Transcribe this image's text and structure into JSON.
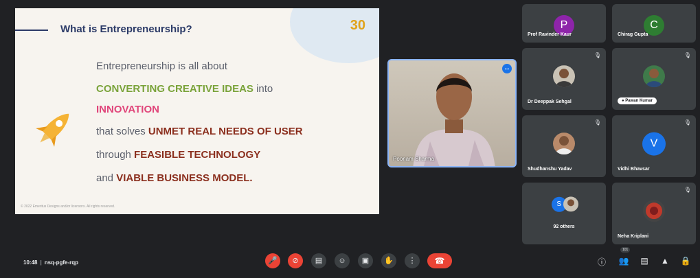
{
  "slide": {
    "title": "What is Entrepreneurship?",
    "logo_num": "30",
    "line1": "Entrepreneurship is all about",
    "line2_bold": "CONVERTING CREATIVE IDEAS",
    "line2_rest": " into",
    "line3": "INNOVATION",
    "line4_pre": "that solves ",
    "line4_bold": "UNMET REAL NEEDS OF USER",
    "line5_pre": "through ",
    "line5_bold": "FEASIBLE TECHNOLOGY",
    "line6_pre": "and ",
    "line6_bold": "VIABLE BUSINESS MODEL.",
    "footer": "© 2022 Emeritus Designs and/or licensors. All rights reserved."
  },
  "speaker": {
    "name": "Poonam Sharma"
  },
  "participants": [
    {
      "name": "Prof Ravinder Kaur",
      "initial": "P",
      "color": "#8e24aa"
    },
    {
      "name": "Chirag Gupta",
      "initial": "C",
      "color": "#2e7d32"
    },
    {
      "name": "Dr Deeppak Sehgal"
    },
    {
      "name": "Pawan Kumar"
    },
    {
      "name": "Shudhanshu Yadav"
    },
    {
      "name": "Vidhi Bhavsar",
      "initial": "V",
      "color": "#1a73e8"
    },
    {
      "name": "92 others",
      "initial": "S"
    },
    {
      "name": "Neha Kriplani"
    }
  ],
  "meeting": {
    "time": "10:48",
    "code": "nsq-pgfe-rqp",
    "people_count": "101"
  },
  "icons": [
    "mic-off-icon",
    "camera-off-icon",
    "captions-icon",
    "emoji-icon",
    "present-icon",
    "raise-hand-icon",
    "more-options-icon",
    "end-call-icon",
    "info-icon",
    "people-icon",
    "chat-icon",
    "activities-icon",
    "host-controls-icon"
  ]
}
